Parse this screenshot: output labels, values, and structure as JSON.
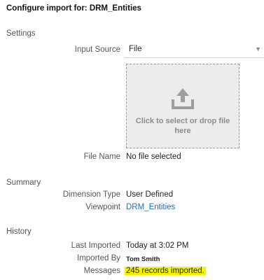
{
  "title": "Configure import for: DRM_Entities",
  "settings": {
    "heading": "Settings",
    "input_source_label": "Input Source",
    "input_source_value": "File",
    "dropzone_text": "Click to select or drop file here",
    "dropzone_icon": "upload-icon",
    "file_name_label": "File Name",
    "file_name_value": "No file selected"
  },
  "summary": {
    "heading": "Summary",
    "dimension_type_label": "Dimension Type",
    "dimension_type_value": "User Defined",
    "viewpoint_label": "Viewpoint",
    "viewpoint_value": "DRM_Entities"
  },
  "history": {
    "heading": "History",
    "last_imported_label": "Last Imported",
    "last_imported_value": "Today at 3:02 PM",
    "imported_by_label": "Imported By",
    "imported_by_value": "Tom Smith",
    "messages_label": "Messages",
    "messages_value": "245 records imported."
  },
  "colors": {
    "link": "#1a6ec2",
    "highlight": "#f6f200"
  }
}
